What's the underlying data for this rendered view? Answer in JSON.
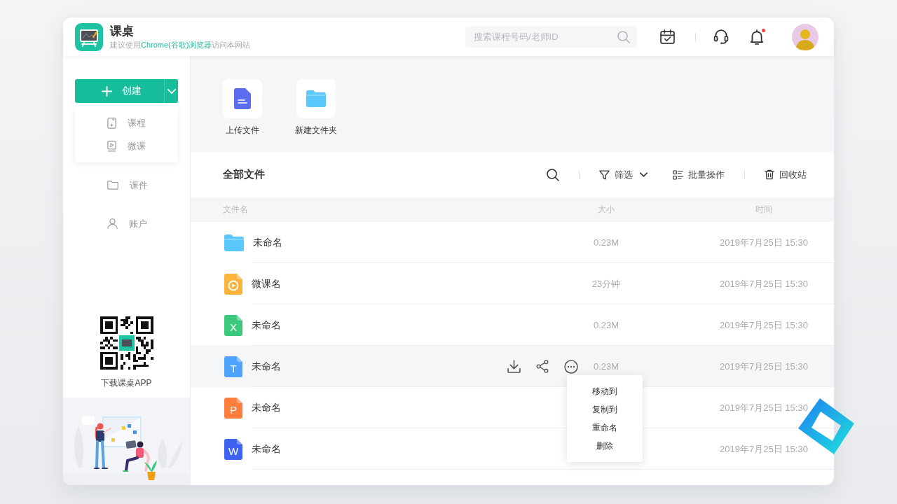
{
  "header": {
    "app_name": "课桌",
    "subtitle": "建议使用**Chrome(谷歌)浏览器**访问本网站",
    "search": {
      "placeholder": "搜索课程号码/老师ID"
    },
    "notifications": {
      "unread": true
    }
  },
  "sidebar": {
    "create_button": {
      "label": "创建",
      "expanded": true,
      "menu": [
        {
          "label": "课程",
          "kind": "course"
        },
        {
          "label": "微课",
          "kind": "micro_lesson"
        }
      ]
    },
    "nav": [
      {
        "label": "课件",
        "kind": "courseware",
        "selected": false
      },
      {
        "label": "账户",
        "kind": "account",
        "selected": false
      }
    ],
    "app_download": {
      "label": "下载课桌APP"
    }
  },
  "quick_actions": [
    {
      "label": "上传文件",
      "kind": "upload"
    },
    {
      "label": "新建文件夹",
      "kind": "new_folder"
    }
  ],
  "files": {
    "title": "全部文件",
    "toolbar": [
      {
        "items": [
          {
            "kind": "search"
          }
        ]
      },
      {
        "items": [
          {
            "kind": "filter",
            "label": "筛选"
          },
          {
            "kind": "batch",
            "label": "批量操作"
          }
        ]
      },
      {
        "items": [
          {
            "kind": "trash",
            "label": "回收站"
          }
        ]
      }
    ],
    "columns": [
      "文件名",
      "大小",
      "时间"
    ],
    "rows": [
      {
        "name": "未命名",
        "kind": "folder",
        "size": "0.23M",
        "time": "2019年7月25日 15:30",
        "highlighted": false
      },
      {
        "name": "微课名",
        "kind": "video",
        "size": "23分钟",
        "time": "2019年7月25日 15:30",
        "highlighted": false
      },
      {
        "name": "未命名",
        "kind": "spreadsheet",
        "letter": "X",
        "size": "0.23M",
        "time": "2019年7月25日 15:30",
        "highlighted": false
      },
      {
        "name": "未命名",
        "kind": "text",
        "letter": "T",
        "size": "0.23M",
        "time": "2019年7月25日 15:30",
        "highlighted": true
      },
      {
        "name": "未命名",
        "kind": "slides",
        "letter": "P",
        "time": "2019年7月25日 15:30",
        "highlighted": false
      },
      {
        "name": "未命名",
        "kind": "document",
        "letter": "W",
        "time": "2019年7月25日 15:30",
        "highlighted": false
      }
    ],
    "context_menu": {
      "open": true,
      "items": [
        "移动到",
        "复制到",
        "重命名",
        "删除"
      ]
    }
  }
}
